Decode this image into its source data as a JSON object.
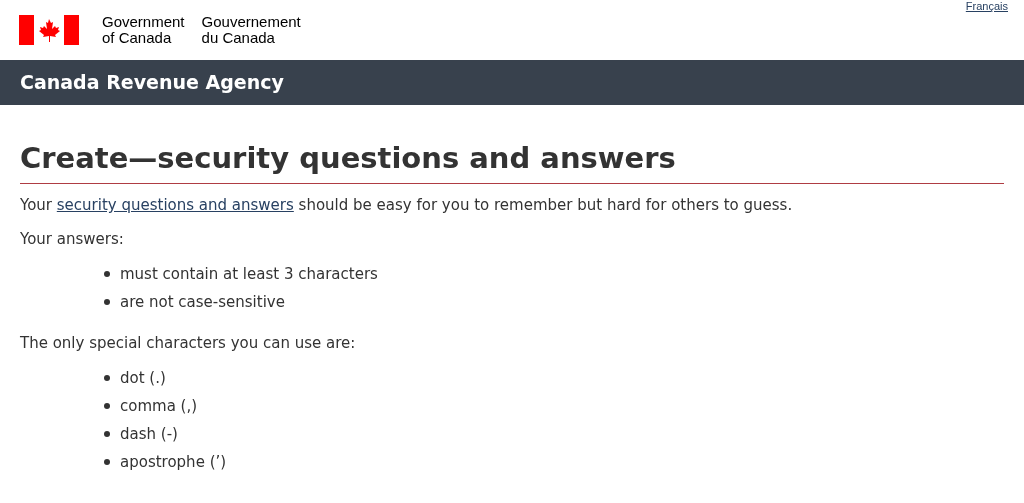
{
  "header": {
    "language_link": "Français",
    "government_en": [
      "Government",
      "of Canada"
    ],
    "government_fr": [
      "Gouvernement",
      "du Canada"
    ]
  },
  "banner": {
    "title": "Canada Revenue Agency"
  },
  "heading": "Create—security questions and answers",
  "intro": {
    "before": "Your ",
    "link": "security questions and answers",
    "after": " should be easy for you to remember but hard for others to guess."
  },
  "sections": [
    {
      "label": "Your answers:",
      "items": [
        "must contain at least 3 characters",
        "are not case-sensitive"
      ]
    },
    {
      "label": "The only special characters you can use are:",
      "items": [
        "dot (.)",
        "comma (,)",
        "dash (-)",
        "apostrophe (’)"
      ]
    }
  ]
}
